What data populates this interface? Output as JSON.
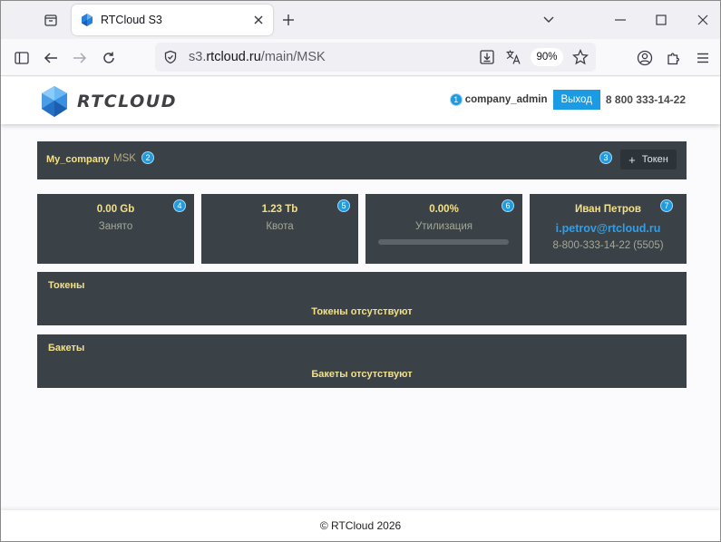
{
  "browser": {
    "tab_title": "RTCloud S3",
    "url_prefix": "s3.",
    "url_domain": "rtcloud.ru",
    "url_path": "/main/MSK",
    "zoom": "90%"
  },
  "header": {
    "logo_text": "RTCLOUD",
    "badge": "1",
    "username": "company_admin",
    "logout_label": "Выход",
    "phone": "8 800 333-14-22"
  },
  "company_bar": {
    "company_name": "My_company",
    "region": "MSK",
    "badge_region": "2",
    "badge_token": "3",
    "token_button_label": "Токен"
  },
  "stats": [
    {
      "value": "0.00 Gb",
      "label": "Занято",
      "badge": "4"
    },
    {
      "value": "1.23 Tb",
      "label": "Квота",
      "badge": "5"
    },
    {
      "value": "0.00%",
      "label": "Утилизация",
      "badge": "6",
      "progress": 0
    }
  ],
  "contact": {
    "name": "Иван Петров",
    "email": "i.petrov@rtcloud.ru",
    "phone": "8-800-333-14-22 (5505)",
    "badge": "7"
  },
  "tokens_section": {
    "title": "Токены",
    "empty_text": "Токены отсутствуют"
  },
  "buckets_section": {
    "title": "Бакеты",
    "empty_text": "Бакеты отсутствуют"
  },
  "footer": {
    "text": "© RTCloud 2026"
  },
  "colors": {
    "panel_bg": "#3b4247",
    "accent_blue": "#1a9be4",
    "panel_text": "#f2e08a"
  }
}
